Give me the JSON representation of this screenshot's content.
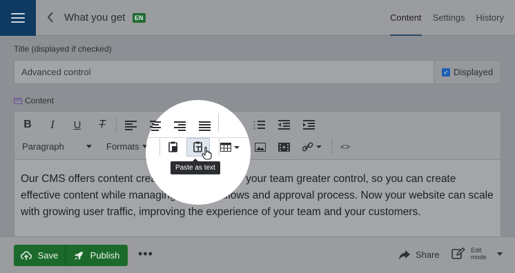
{
  "header": {
    "title": "What you get",
    "lang_badge": "EN",
    "tabs": [
      {
        "label": "Content",
        "active": true
      },
      {
        "label": "Settings",
        "active": false
      },
      {
        "label": "History",
        "active": false
      }
    ]
  },
  "title_field": {
    "label": "Title (displayed if checked)",
    "value": "Advanced control",
    "checkbox_label": "Displayed",
    "checked": true
  },
  "content_label": "Content",
  "toolbar": {
    "block_format": "Paragraph",
    "formats": "Formats",
    "tooltip": "Paste as text"
  },
  "editor": {
    "body": "Our CMS offers content creation tools that give your team greater control, so you can create effective content while managing your workflows and approval process. Now your website can scale with growing user traffic, improving the experience of your team and your customers."
  },
  "footer": {
    "save": "Save",
    "publish": "Publish",
    "share": "Share",
    "edit_mode": "Edit mode"
  },
  "colors": {
    "brand_navy": "#0f3b62",
    "publish_green": "#1b6a2c",
    "badge_green": "#1f6b33",
    "checkbox_blue": "#1d5fb3"
  },
  "icons": [
    "menu-icon",
    "back-chevron-icon",
    "bold-icon",
    "italic-icon",
    "underline-icon",
    "clear-format-icon",
    "align-left-icon",
    "align-center-icon",
    "align-right-icon",
    "justify-icon",
    "bullet-list-icon",
    "numbered-list-icon",
    "outdent-icon",
    "indent-icon",
    "paste-icon",
    "paste-as-text-icon",
    "table-icon",
    "image-icon",
    "media-icon",
    "link-icon",
    "code-icon",
    "share-icon",
    "edit-mode-icon",
    "more-icon"
  ]
}
